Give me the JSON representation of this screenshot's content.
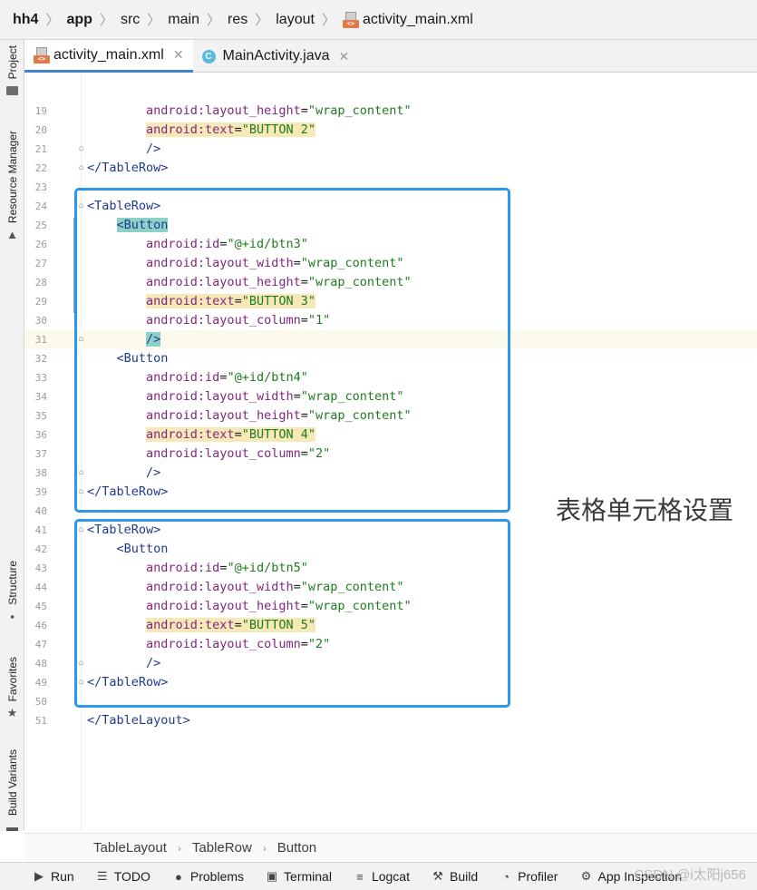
{
  "breadcrumb": {
    "items": [
      "hh4",
      "app",
      "src",
      "main",
      "res",
      "layout"
    ],
    "file": "activity_main.xml",
    "file_icon": "xml-file-icon"
  },
  "left_tools": {
    "project": "Project",
    "resource_manager": "Resource Manager",
    "structure": "Structure",
    "favorites": "Favorites",
    "build_variants": "Build Variants"
  },
  "tabs": [
    {
      "label": "activity_main.xml",
      "icon": "xml-file-icon",
      "active": true
    },
    {
      "label": "MainActivity.java",
      "icon": "java-class-icon",
      "active": false
    }
  ],
  "editor": {
    "current_line": "31",
    "lines": [
      {
        "n": "19",
        "indent": "        ",
        "attr": "android:layout_height",
        "val": "\"wrap_content\""
      },
      {
        "n": "20",
        "indent": "        ",
        "attr": "android:text",
        "val": "\"BUTTON 2\"",
        "hl": true
      },
      {
        "n": "21",
        "indent": "        ",
        "raw": "/>"
      },
      {
        "n": "22",
        "indent": "",
        "raw": "</TableRow>"
      },
      {
        "n": "23",
        "indent": "",
        "raw": ""
      },
      {
        "n": "24",
        "indent": "",
        "raw": "<TableRow>"
      },
      {
        "n": "25",
        "indent": "    ",
        "raw": "<Button",
        "hltag": true
      },
      {
        "n": "26",
        "indent": "        ",
        "attr": "android:id",
        "val": "\"@+id/btn3\""
      },
      {
        "n": "27",
        "indent": "        ",
        "attr": "android:layout_width",
        "val": "\"wrap_content\""
      },
      {
        "n": "28",
        "indent": "        ",
        "attr": "android:layout_height",
        "val": "\"wrap_content\""
      },
      {
        "n": "29",
        "indent": "        ",
        "attr": "android:text",
        "val": "\"BUTTON 3\"",
        "hl": true
      },
      {
        "n": "30",
        "indent": "        ",
        "attr": "android:layout_column",
        "val": "\"1\""
      },
      {
        "n": "31",
        "indent": "        ",
        "raw": "/>",
        "hltag": true
      },
      {
        "n": "32",
        "indent": "    ",
        "raw": "<Button"
      },
      {
        "n": "33",
        "indent": "        ",
        "attr": "android:id",
        "val": "\"@+id/btn4\""
      },
      {
        "n": "34",
        "indent": "        ",
        "attr": "android:layout_width",
        "val": "\"wrap_content\""
      },
      {
        "n": "35",
        "indent": "        ",
        "attr": "android:layout_height",
        "val": "\"wrap_content\""
      },
      {
        "n": "36",
        "indent": "        ",
        "attr": "android:text",
        "val": "\"BUTTON 4\"",
        "hl": true
      },
      {
        "n": "37",
        "indent": "        ",
        "attr": "android:layout_column",
        "val": "\"2\""
      },
      {
        "n": "38",
        "indent": "        ",
        "raw": "/>"
      },
      {
        "n": "39",
        "indent": "",
        "raw": "</TableRow>"
      },
      {
        "n": "40",
        "indent": "",
        "raw": ""
      },
      {
        "n": "41",
        "indent": "",
        "raw": "<TableRow>"
      },
      {
        "n": "42",
        "indent": "    ",
        "raw": "<Button"
      },
      {
        "n": "43",
        "indent": "        ",
        "attr": "android:id",
        "val": "\"@+id/btn5\""
      },
      {
        "n": "44",
        "indent": "        ",
        "attr": "android:layout_width",
        "val": "\"wrap_content\""
      },
      {
        "n": "45",
        "indent": "        ",
        "attr": "android:layout_height",
        "val": "\"wrap_content\""
      },
      {
        "n": "46",
        "indent": "        ",
        "attr": "android:text",
        "val": "\"BUTTON 5\"",
        "hl": true
      },
      {
        "n": "47",
        "indent": "        ",
        "attr": "android:layout_column",
        "val": "\"2\""
      },
      {
        "n": "48",
        "indent": "        ",
        "raw": "/>"
      },
      {
        "n": "49",
        "indent": "",
        "raw": "</TableRow>"
      },
      {
        "n": "50",
        "indent": "",
        "raw": ""
      },
      {
        "n": "51",
        "indent": "",
        "raw": "</TableLayout>"
      }
    ]
  },
  "annotation": {
    "label": "表格单元格设置",
    "color": "#2b97ef"
  },
  "editor_breadcrumb": [
    "TableLayout",
    "TableRow",
    "Button"
  ],
  "tool_windows": [
    {
      "label": "Run",
      "icon": "play-icon"
    },
    {
      "label": "TODO",
      "icon": "list-icon"
    },
    {
      "label": "Problems",
      "icon": "problems-icon"
    },
    {
      "label": "Terminal",
      "icon": "terminal-icon"
    },
    {
      "label": "Logcat",
      "icon": "logcat-icon"
    },
    {
      "label": "Build",
      "icon": "hammer-icon"
    },
    {
      "label": "Profiler",
      "icon": "gauge-icon"
    },
    {
      "label": "App Inspection",
      "icon": "inspection-icon"
    }
  ],
  "watermark": "CSDN @i太阳j656"
}
